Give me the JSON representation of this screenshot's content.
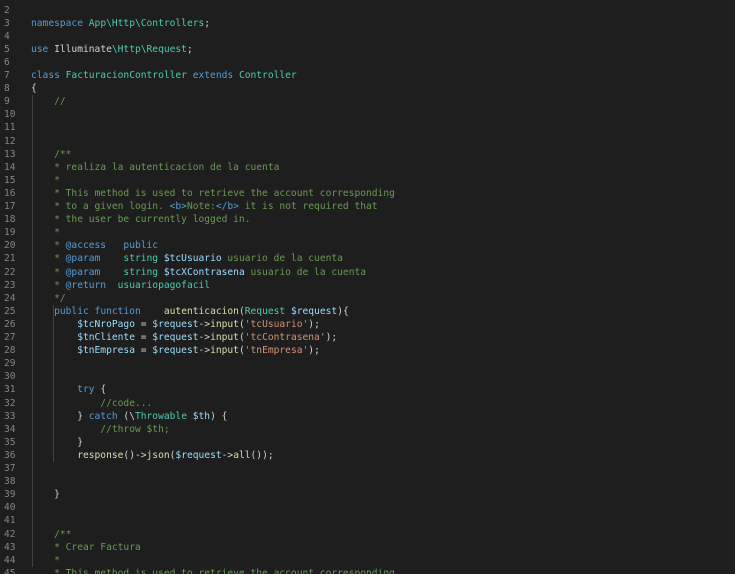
{
  "editor": {
    "first_line_number": 2,
    "lines": [
      [],
      [
        [
          "namespace ",
          "kw"
        ],
        [
          "App\\Http\\Controllers",
          "ns"
        ],
        [
          ";",
          "plain"
        ]
      ],
      [],
      [
        [
          "use ",
          "kw"
        ],
        [
          "Illuminate",
          "plain"
        ],
        [
          "\\Http\\",
          "ns"
        ],
        [
          "Request",
          "cls"
        ],
        [
          ";",
          "plain"
        ]
      ],
      [],
      [
        [
          "class ",
          "kw"
        ],
        [
          "FacturacionController ",
          "cls"
        ],
        [
          "extends ",
          "kw"
        ],
        [
          "Controller",
          "cls"
        ]
      ],
      [
        [
          "{",
          "plain"
        ]
      ],
      [
        [
          "    //",
          "com"
        ]
      ],
      [],
      [],
      [],
      [
        [
          "    /**",
          "com"
        ]
      ],
      [
        [
          "    * realiza la autenticacion de la cuenta",
          "com"
        ]
      ],
      [
        [
          "    *",
          "com"
        ]
      ],
      [
        [
          "    * This method is used to retrieve the account corresponding",
          "com"
        ]
      ],
      [
        [
          "    * to a given login. ",
          "com"
        ],
        [
          "<b>",
          "tag"
        ],
        [
          "Note:",
          "com"
        ],
        [
          "</b>",
          "tag"
        ],
        [
          " it is not required that",
          "com"
        ]
      ],
      [
        [
          "    * the user be currently logged in.",
          "com"
        ]
      ],
      [
        [
          "    *",
          "com"
        ]
      ],
      [
        [
          "    * ",
          "com"
        ],
        [
          "@access",
          "kw"
        ],
        [
          "   public",
          "kw"
        ]
      ],
      [
        [
          "    * ",
          "com"
        ],
        [
          "@param",
          "kw"
        ],
        [
          "    string ",
          "cls"
        ],
        [
          "$tcUsuario",
          "var"
        ],
        [
          " usuario de la cuenta",
          "com"
        ]
      ],
      [
        [
          "    * ",
          "com"
        ],
        [
          "@param",
          "kw"
        ],
        [
          "    string ",
          "cls"
        ],
        [
          "$tcXContrasena",
          "var"
        ],
        [
          " usuario de la cuenta",
          "com"
        ]
      ],
      [
        [
          "    * ",
          "com"
        ],
        [
          "@return",
          "kw"
        ],
        [
          "  usuariopagofacil",
          "cls"
        ]
      ],
      [
        [
          "    */",
          "com"
        ]
      ],
      [
        [
          "    public ",
          "kw"
        ],
        [
          "function",
          "kw"
        ],
        [
          "    ",
          "plain"
        ],
        [
          "autenticacion",
          "fn"
        ],
        [
          "(",
          "plain"
        ],
        [
          "Request ",
          "cls"
        ],
        [
          "$request",
          "var"
        ],
        [
          "){",
          "plain"
        ]
      ],
      [
        [
          "        $tcNroPago",
          "var"
        ],
        [
          " = ",
          "plain"
        ],
        [
          "$request",
          "var"
        ],
        [
          "->",
          "plain"
        ],
        [
          "input",
          "fn"
        ],
        [
          "(",
          "plain"
        ],
        [
          "'tcUsuario'",
          "str"
        ],
        [
          ");",
          "plain"
        ]
      ],
      [
        [
          "        $tnCliente",
          "var"
        ],
        [
          " = ",
          "plain"
        ],
        [
          "$request",
          "var"
        ],
        [
          "->",
          "plain"
        ],
        [
          "input",
          "fn"
        ],
        [
          "(",
          "plain"
        ],
        [
          "'tcContrasena'",
          "str"
        ],
        [
          ");",
          "plain"
        ]
      ],
      [
        [
          "        $tnEmpresa",
          "var"
        ],
        [
          " = ",
          "plain"
        ],
        [
          "$request",
          "var"
        ],
        [
          "->",
          "plain"
        ],
        [
          "input",
          "fn"
        ],
        [
          "(",
          "plain"
        ],
        [
          "'tnEmpresa'",
          "str"
        ],
        [
          ");",
          "plain"
        ]
      ],
      [],
      [],
      [
        [
          "        try ",
          "kw"
        ],
        [
          "{",
          "plain"
        ]
      ],
      [
        [
          "            //code...",
          "com"
        ]
      ],
      [
        [
          "        } ",
          "plain"
        ],
        [
          "catch ",
          "kw"
        ],
        [
          "(\\",
          "plain"
        ],
        [
          "Throwable ",
          "cls"
        ],
        [
          "$th",
          "var"
        ],
        [
          ") {",
          "plain"
        ]
      ],
      [
        [
          "            //throw $th;",
          "com"
        ]
      ],
      [
        [
          "        }",
          "plain"
        ]
      ],
      [
        [
          "        response",
          "fn"
        ],
        [
          "()->",
          "plain"
        ],
        [
          "json",
          "fn"
        ],
        [
          "(",
          "plain"
        ],
        [
          "$request",
          "var"
        ],
        [
          "->",
          "plain"
        ],
        [
          "all",
          "fn"
        ],
        [
          "());",
          "plain"
        ]
      ],
      [],
      [],
      [
        [
          "    }",
          "plain"
        ]
      ],
      [],
      [],
      [
        [
          "    /**",
          "com"
        ]
      ],
      [
        [
          "    * Crear Factura",
          "com"
        ]
      ],
      [
        [
          "    *",
          "com"
        ]
      ],
      [
        [
          "    * This method is used to retrieve the account corresponding",
          "com"
        ]
      ]
    ]
  }
}
